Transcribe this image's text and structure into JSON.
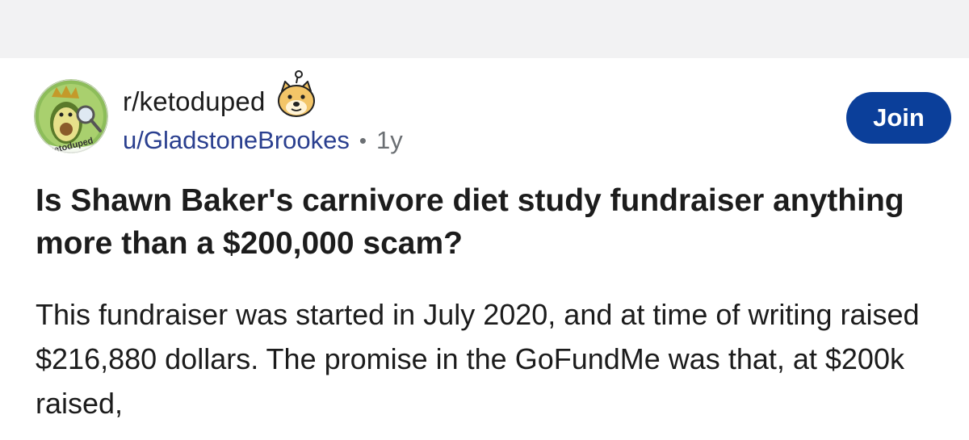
{
  "post": {
    "subreddit": "r/ketoduped",
    "username": "u/GladstoneBrookes",
    "separator": "•",
    "age": "1y",
    "join_label": "Join",
    "avatar_text": "ketoduped",
    "title": "Is Shawn Baker's carnivore diet study fundraiser anything more than a $200,000 scam?",
    "body": "This fundraiser was started in July 2020, and at time of writing raised $216,880 dollars. The promise in the GoFundMe was that, at $200k raised,"
  },
  "colors": {
    "top_bar": "#f2f2f3",
    "join_button": "#0b3f9a",
    "username": "#2a3f8f",
    "muted_text": "#6b6f73",
    "text": "#1c1c1c"
  },
  "icons": {
    "avatar": "avocado-detective-icon",
    "snoo": "doge-snoo-icon"
  }
}
